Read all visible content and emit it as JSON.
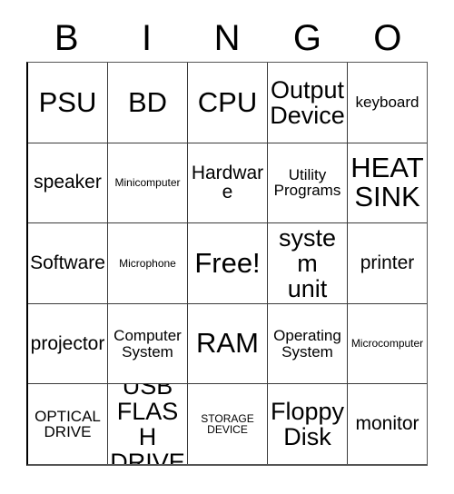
{
  "card": {
    "header": {
      "letters": [
        "B",
        "I",
        "N",
        "G",
        "O"
      ]
    },
    "grid": {
      "columns": 5,
      "rows": 5,
      "cells": [
        [
          {
            "label": "PSU",
            "size": "xl"
          },
          {
            "label": "BD",
            "size": "xl"
          },
          {
            "label": "CPU",
            "size": "xl"
          },
          {
            "label": "Output\nDevice",
            "size": "lg"
          },
          {
            "label": "keyboard",
            "size": "sm"
          }
        ],
        [
          {
            "label": "speaker",
            "size": "md"
          },
          {
            "label": "Minicomputer",
            "size": "xs"
          },
          {
            "label": "Hardware",
            "size": "md"
          },
          {
            "label": "Utility\nPrograms",
            "size": "sm"
          },
          {
            "label": "HEAT\nSINK",
            "size": "xl"
          }
        ],
        [
          {
            "label": "Software",
            "size": "md"
          },
          {
            "label": "Microphone",
            "size": "xs"
          },
          {
            "label": "Free!",
            "size": "xl"
          },
          {
            "label": "system\nunit",
            "size": "lg"
          },
          {
            "label": "printer",
            "size": "md"
          }
        ],
        [
          {
            "label": "projector",
            "size": "md"
          },
          {
            "label": "Computer\nSystem",
            "size": "sm"
          },
          {
            "label": "RAM",
            "size": "xl"
          },
          {
            "label": "Operating\nSystem",
            "size": "sm"
          },
          {
            "label": "Microcomputer",
            "size": "xs"
          }
        ],
        [
          {
            "label": "OPTICAL\nDRIVE",
            "size": "sm"
          },
          {
            "label": "USB\nFLASH\nDRIVE",
            "size": "lg"
          },
          {
            "label": "STORAGE\nDEVICE",
            "size": "xs"
          },
          {
            "label": "Floppy\nDisk",
            "size": "lg"
          },
          {
            "label": "monitor",
            "size": "md"
          }
        ]
      ],
      "free_space": {
        "row": 2,
        "column": 2,
        "label": "Free!"
      }
    },
    "colors": {
      "background": "#ffffff",
      "text": "#000000",
      "grid_line": "#3a3a3a",
      "border": "#555555"
    }
  }
}
